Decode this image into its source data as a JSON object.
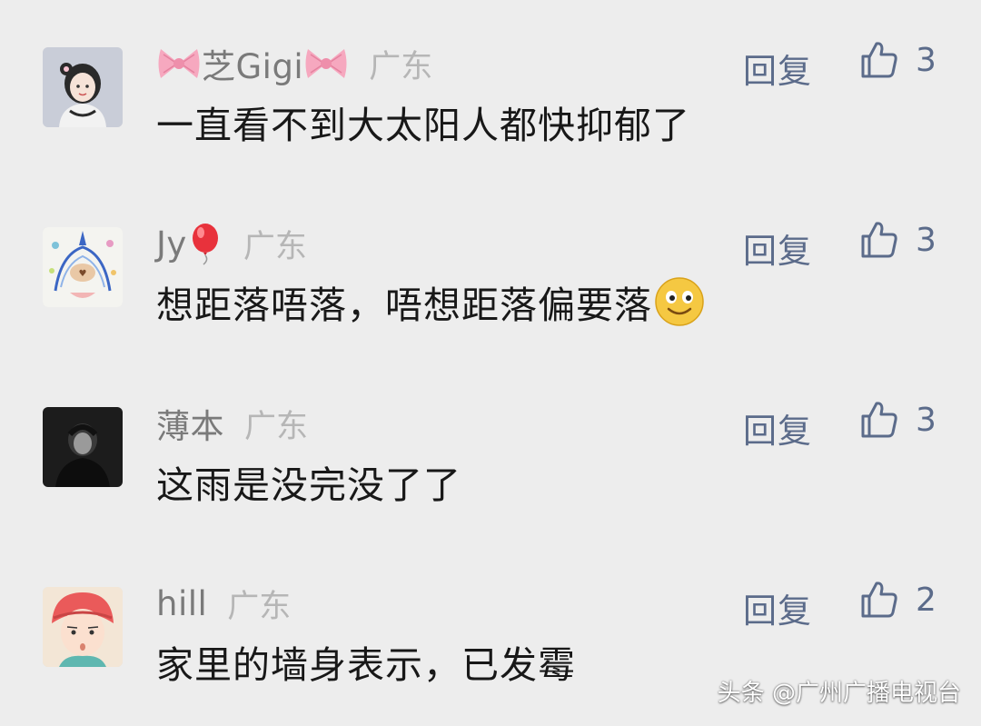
{
  "comments": [
    {
      "username": "芝Gigi",
      "username_decoration": "bow-emoji",
      "location": "广东",
      "text": "一直看不到大太阳人都快抑郁了",
      "reply_label": "回复",
      "likes": "3"
    },
    {
      "username": "Jy",
      "username_decoration": "balloon-emoji",
      "location": "广东",
      "text": "想距落唔落，唔想距落偏要落",
      "text_emoji": "smile-emoji",
      "reply_label": "回复",
      "likes": "3"
    },
    {
      "username": "薄本",
      "location": "广东",
      "text": "这雨是没完没了了",
      "reply_label": "回复",
      "likes": "3"
    },
    {
      "username": "hill",
      "location": "广东",
      "text": "家里的墙身表示，已发霉",
      "reply_label": "回复",
      "likes": "2"
    }
  ],
  "watermark": "头条 @广州广播电视台",
  "colors": {
    "background": "#ededed",
    "username": "#7a7a7a",
    "location": "#b6b6b6",
    "text": "#181818",
    "action": "#5b6b8a"
  }
}
